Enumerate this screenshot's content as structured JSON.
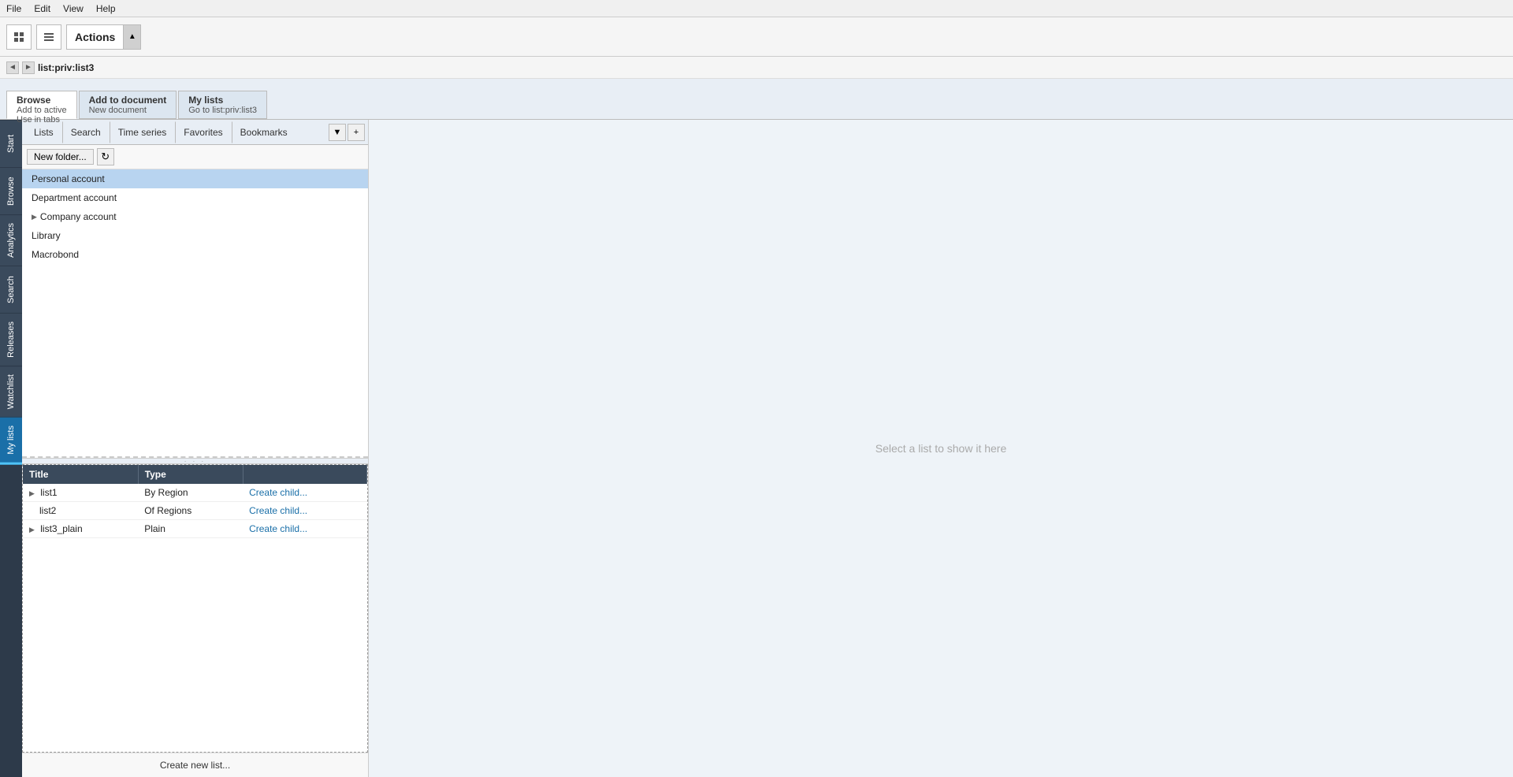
{
  "menu": {
    "items": [
      "File",
      "Edit",
      "View",
      "Help"
    ]
  },
  "toolbar": {
    "actions_label": "Actions",
    "actions_arrow": "▲"
  },
  "path_bar": {
    "nav_back": "◄",
    "nav_fwd": "►",
    "path": "list:priv:list3"
  },
  "tab_group": {
    "tabs": [
      {
        "main": "Browse",
        "sub": "Add to active\nUse in tabs",
        "active": true
      },
      {
        "main": "Add to document",
        "sub": "New document",
        "active": false
      },
      {
        "main": "My lists",
        "sub": "Go to list:priv:list3",
        "active": false
      }
    ]
  },
  "vertical_nav": {
    "items": [
      "Start",
      "Browse",
      "Analytics",
      "Search",
      "Releases",
      "Watchlist",
      "My lists"
    ]
  },
  "panel_tabs": {
    "tabs": [
      "Lists",
      "Search",
      "Time series",
      "Favorites",
      "Bookmarks"
    ],
    "dropdown": "▼",
    "add": "+"
  },
  "folder_toolbar": {
    "new_folder_btn": "New folder...",
    "refresh_icon": "↻"
  },
  "folder_tree": {
    "items": [
      {
        "name": "Personal account",
        "selected": true,
        "arrow": false
      },
      {
        "name": "Department account",
        "selected": false,
        "arrow": false
      },
      {
        "name": "Company account",
        "selected": false,
        "arrow": true
      },
      {
        "name": "Library",
        "selected": false,
        "arrow": false
      },
      {
        "name": "Macrobond",
        "selected": false,
        "arrow": false
      }
    ]
  },
  "table": {
    "columns": [
      "Title",
      "Type",
      ""
    ],
    "rows": [
      {
        "name": "list1",
        "type": "By Region",
        "action": "Create child...",
        "expandable": true
      },
      {
        "name": "list2",
        "type": "Of Regions",
        "action": "Create child...",
        "expandable": false
      },
      {
        "name": "list3_plain",
        "type": "Plain",
        "action": "Create child...",
        "expandable": true
      }
    ]
  },
  "create_new_list": "Create new list...",
  "right_content": {
    "hint": "Select a list to show it here"
  }
}
